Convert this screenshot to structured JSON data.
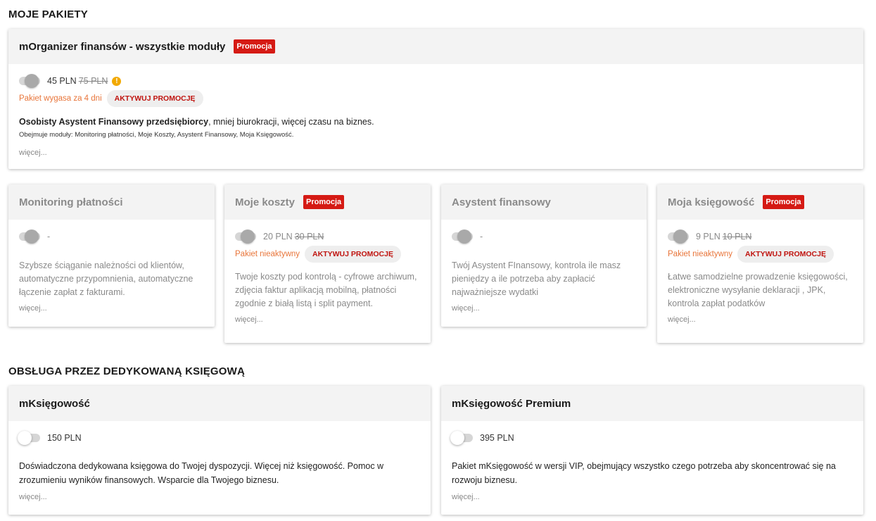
{
  "sections": {
    "my_packages": "MOJE PAKIETY",
    "accountant": "OBSŁUGA PRZEZ DEDYKOWANĄ KSIĘGOWĄ"
  },
  "main_package": {
    "title": "mOrganizer finansów - wszystkie moduły",
    "badge": "Promocja",
    "price": "45 PLN",
    "old_price": "75 PLN",
    "warning_symbol": "!",
    "status": "Pakiet wygasa za 4 dni",
    "promo_button": "AKTYWUJ PROMOCJĘ",
    "desc_bold": "Osobisty Asystent Finansowy przedsiębiorcy",
    "desc_rest": ", mniej biurokracji, więcej czasu na biznes.",
    "modules": "Obejmuje moduły: Monitoring płatności, Moje Koszty, Asystent Finansowy, Moja Księgowość.",
    "more": "więcej..."
  },
  "modules": [
    {
      "title": "Monitoring płatności",
      "price": "-",
      "desc": "Szybsze ściąganie należności od klientów, automatyczne przypomnienia, automatyczne łączenie zapłat z fakturami.",
      "more": "więcej..."
    },
    {
      "title": "Moje koszty",
      "badge": "Promocja",
      "price": "20 PLN",
      "old_price": "30 PLN",
      "status": "Pakiet nieaktywny",
      "promo_button": "AKTYWUJ PROMOCJĘ",
      "desc": "Twoje koszty pod kontrolą - cyfrowe archiwum, zdjęcia faktur aplikacją mobilną, płatności zgodnie z białą listą i split payment.",
      "more": "więcej..."
    },
    {
      "title": "Asystent finansowy",
      "price": "-",
      "desc": "Twój Asystent FInansowy, kontrola ile masz pieniędzy a ile potrzeba aby zapłacić najważniejsze wydatki",
      "more": "więcej..."
    },
    {
      "title": "Moja księgowość",
      "badge": "Promocja",
      "price": "9 PLN",
      "old_price": "10 PLN",
      "status": "Pakiet nieaktywny",
      "promo_button": "AKTYWUJ PROMOCJĘ",
      "desc": "Łatwe samodzielne prowadzenie księgowości, elektroniczne wysyłanie deklaracji , JPK, kontrola zapłat podatków",
      "more": "więcej..."
    }
  ],
  "accountant_packages": [
    {
      "title": "mKsięgowość",
      "price": "150 PLN",
      "desc": "Doświadczona dedykowana księgowa do Twojej dyspozycji. Więcej niż księgowość. Pomoc w zrozumieniu wyników finansowych. Wsparcie dla Twojego biznesu.",
      "more": "więcej..."
    },
    {
      "title": "mKsięgowość Premium",
      "price": "395 PLN",
      "desc": "Pakiet mKsięgowość w wersji VIP, obejmujący wszystko czego potrzeba aby skoncentrować się na rozwoju biznesu.",
      "more": "więcej..."
    }
  ],
  "colors": {
    "badge": "#d51a14",
    "status": "#e8753a",
    "promo_text": "#c0140f",
    "warning": "#f2a900",
    "header_bg": "#f3f3f3"
  }
}
